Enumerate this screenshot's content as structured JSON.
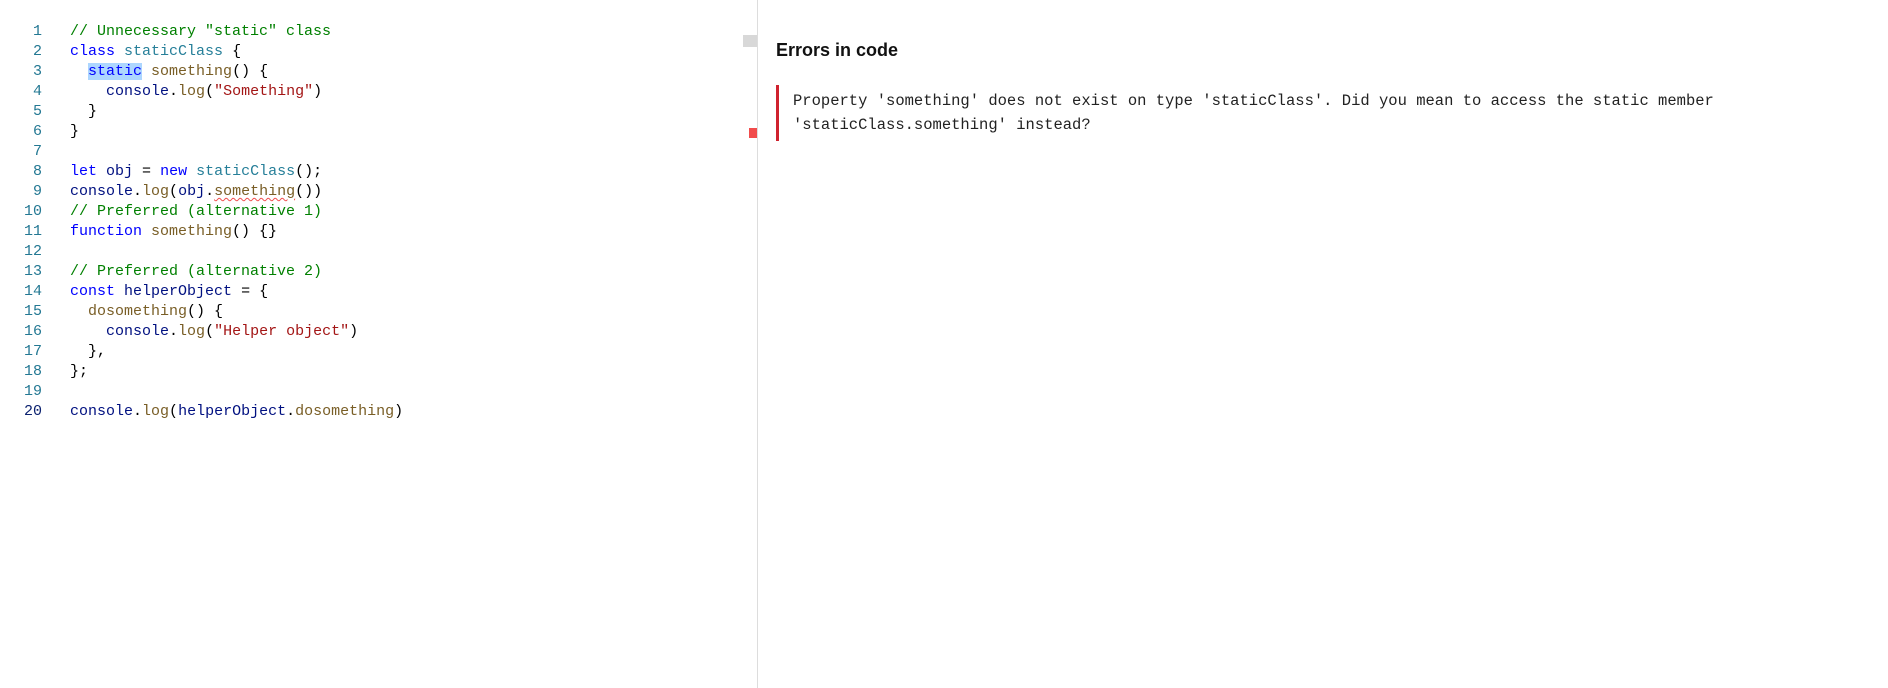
{
  "editor": {
    "lineNumbers": [
      "1",
      "2",
      "3",
      "4",
      "5",
      "6",
      "7",
      "8",
      "9",
      "10",
      "11",
      "12",
      "13",
      "14",
      "15",
      "16",
      "17",
      "18",
      "19",
      "20"
    ],
    "activeLine": 20,
    "code": {
      "l1": {
        "comment": "// Unnecessary \"static\" class"
      },
      "l2": {
        "kw": "class",
        "sp": " ",
        "type": "staticClass",
        "rest": " {"
      },
      "l3": {
        "indent": "  ",
        "sel": "static",
        "sp": " ",
        "func": "something",
        "rest": "() {"
      },
      "l4": {
        "indent1": "    ",
        "obj": "console",
        "dot1": ".",
        "method": "log",
        "open": "(",
        "str": "\"Something\"",
        "close": ")"
      },
      "l5": {
        "indent": "  ",
        "brace": "}"
      },
      "l6": {
        "brace": "}"
      },
      "l7": {
        "empty": ""
      },
      "l8": {
        "kw": "let",
        "sp": " ",
        "var": "obj",
        "eq": " = ",
        "kw2": "new",
        "sp2": " ",
        "type": "staticClass",
        "rest": "();"
      },
      "l9": {
        "obj": "console",
        "dot": ".",
        "method": "log",
        "open": "(",
        "var": "obj",
        "dot2": ".",
        "err": "something",
        "close": "())"
      },
      "l10": {
        "comment": "// Preferred (alternative 1)"
      },
      "l11": {
        "kw": "function",
        "sp": " ",
        "func": "something",
        "rest": "() {}"
      },
      "l12": {
        "empty": ""
      },
      "l13": {
        "comment": "// Preferred (alternative 2)"
      },
      "l14": {
        "kw": "const",
        "sp": " ",
        "var": "helperObject",
        "rest": " = {"
      },
      "l15": {
        "indent": "  ",
        "func": "dosomething",
        "rest": "() {"
      },
      "l16": {
        "indent1": "    ",
        "obj": "console",
        "dot1": ".",
        "method": "log",
        "open": "(",
        "str": "\"Helper object\"",
        "close": ")"
      },
      "l17": {
        "indent": "  ",
        "rest": "},"
      },
      "l18": {
        "rest": "};"
      },
      "l19": {
        "empty": ""
      },
      "l20": {
        "obj": "console",
        "dot": ".",
        "method": "log",
        "open": "(",
        "var": "helperObject",
        "dot2": ".",
        "prop": "dosomething",
        "close": ")"
      }
    }
  },
  "errors": {
    "title": "Errors in code",
    "items": [
      "Property 'something' does not exist on type 'staticClass'. Did you mean to access the static member 'staticClass.something' instead?"
    ]
  }
}
